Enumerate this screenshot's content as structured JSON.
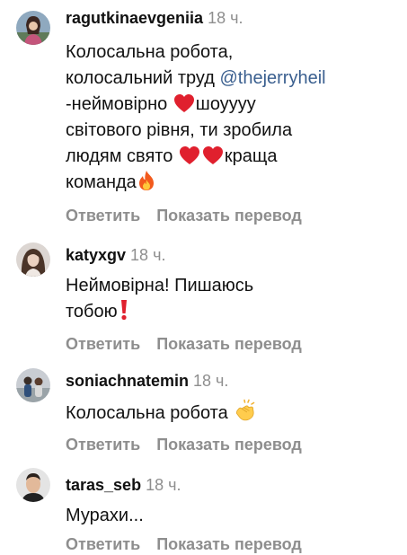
{
  "comments": [
    {
      "username": "ragutkinaevgeniia",
      "time": "18 ч.",
      "line1": "Колосальна робота,",
      "line2_a": "колосальний труд ",
      "mention": "@thejerryheil",
      "line3_a": "-неймовірно ",
      "line3_b": "шоуууу",
      "line4": "світового рівня, ти зробила",
      "line5_a": "людям свято ",
      "line5_b": "краща",
      "line6": "команда",
      "emojis": [
        "red-heart-icon",
        "red-heart-icon",
        "red-heart-icon",
        "fire-icon"
      ],
      "reply_label": "Ответить",
      "translate_label": "Показать перевод"
    },
    {
      "username": "katyxgv",
      "time": "18 ч.",
      "line1": "Неймовірна! Пишаюсь",
      "line2": "тобою",
      "emojis": [
        "red-exclamation-icon"
      ],
      "reply_label": "Ответить",
      "translate_label": "Показать перевод"
    },
    {
      "username": "soniachnatemin",
      "time": "18 ч.",
      "line1": "Колосальна робота",
      "emojis": [
        "clapping-hands-icon"
      ],
      "reply_label": "Ответить",
      "translate_label": "Показать перевод"
    },
    {
      "username": "taras_seb",
      "time": "18 ч.",
      "line1": "Мурахи...",
      "reply_label": "Ответить",
      "translate_label": "Показать перевод"
    }
  ],
  "colors": {
    "text": "#111111",
    "secondary": "#8e8e8e",
    "mention": "#3a5f8f",
    "heart": "#e0202e"
  }
}
